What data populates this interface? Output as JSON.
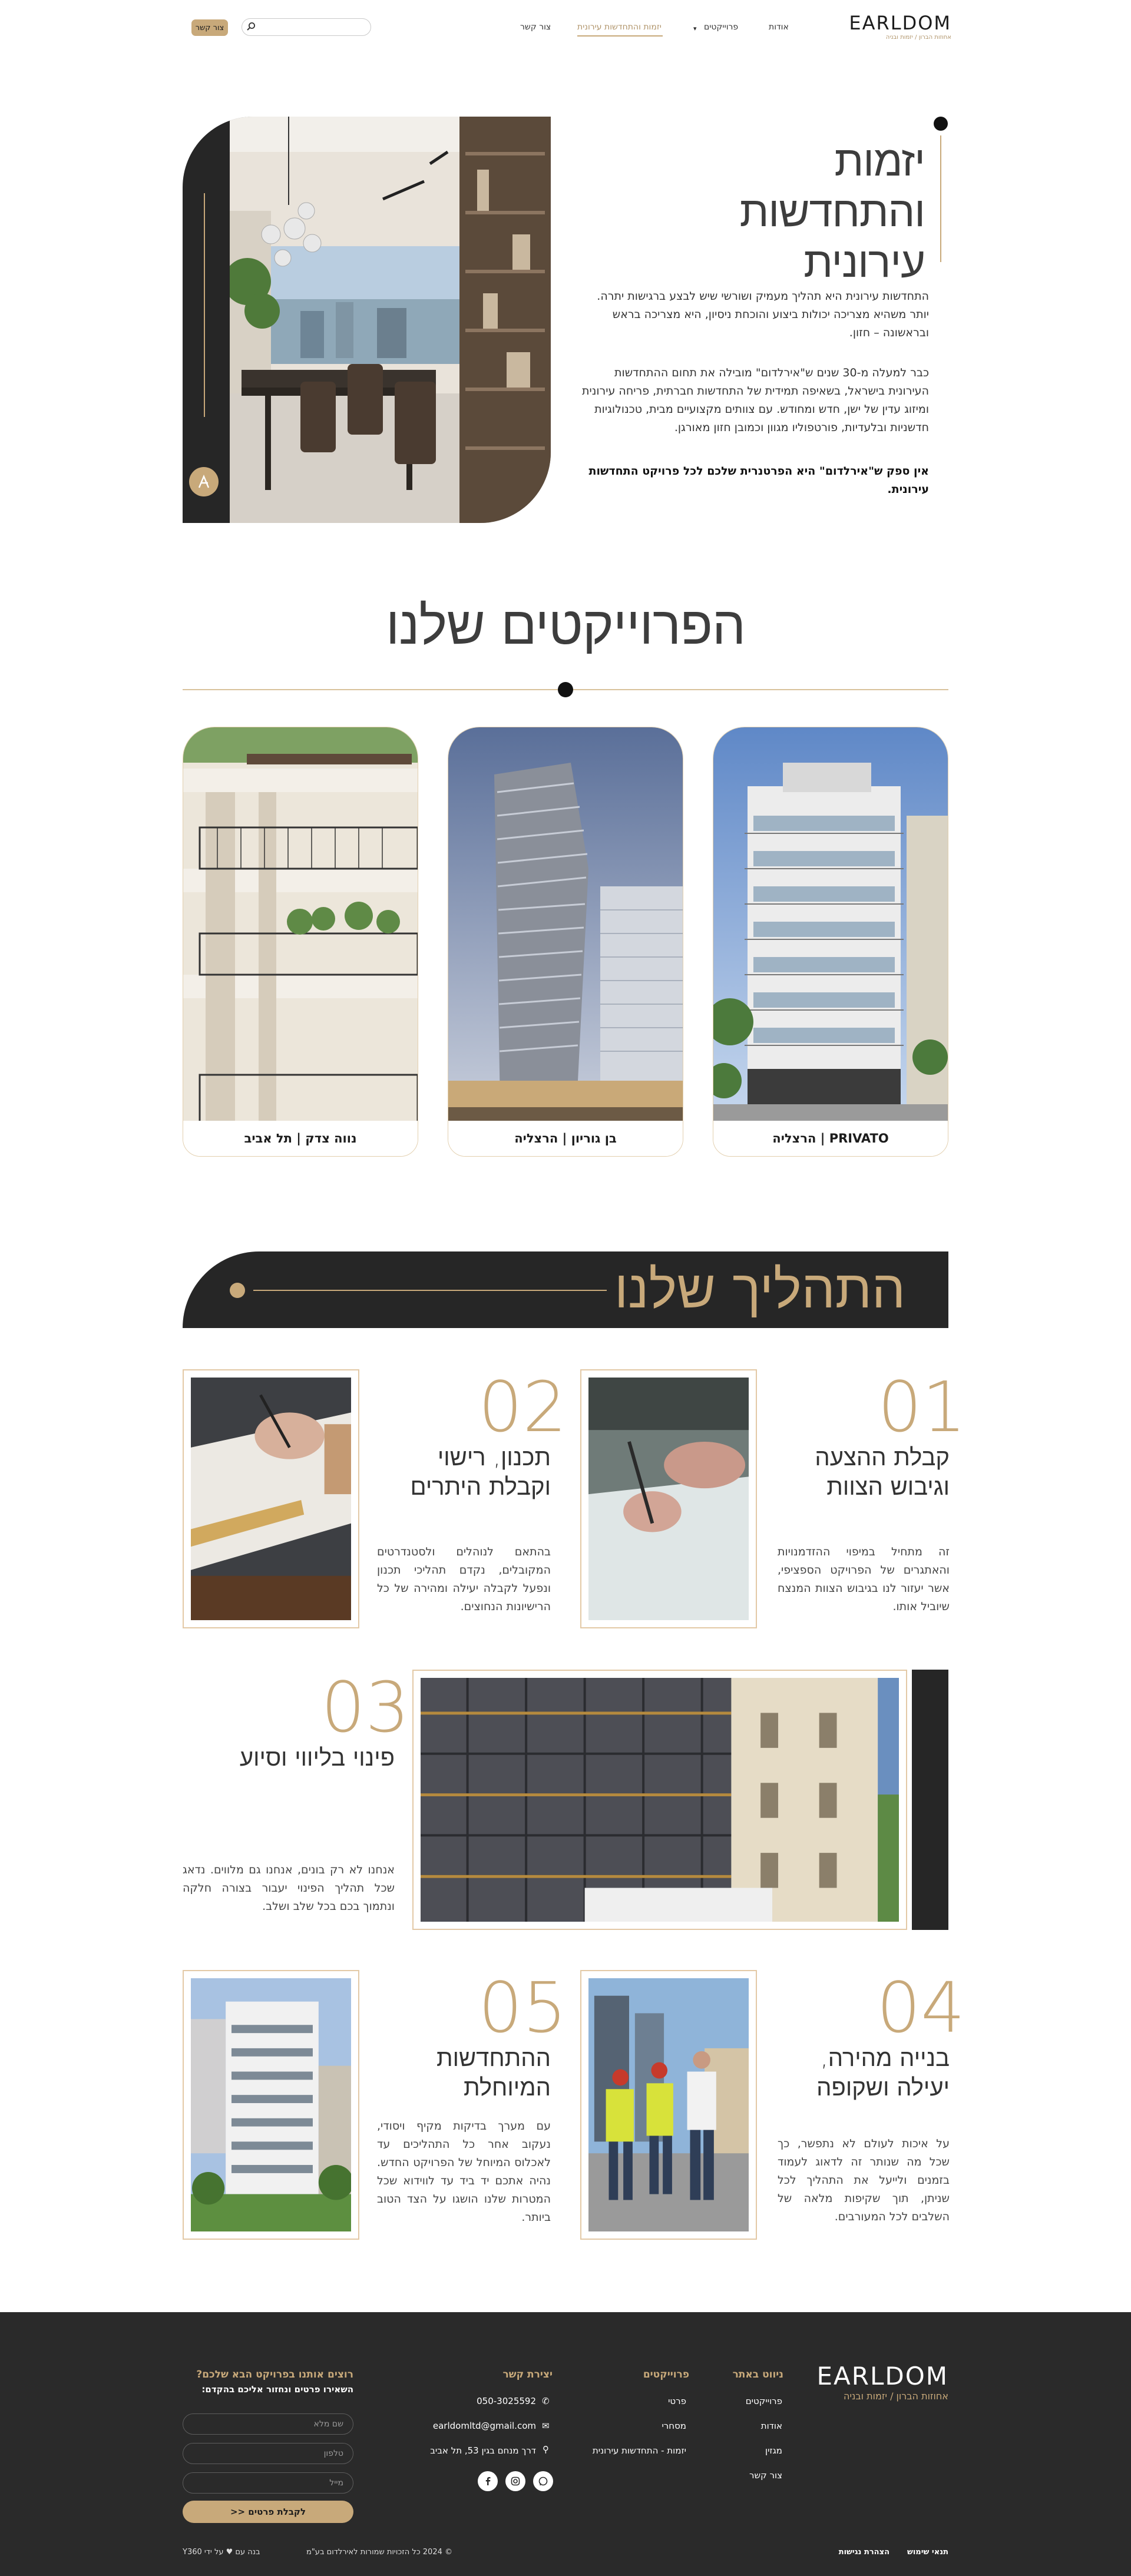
{
  "header": {
    "logo_main": "EARLDOM",
    "logo_sub": "אחוזות הברון / יזמות ובניה",
    "nav": [
      {
        "label": "אודות",
        "key": "about"
      },
      {
        "label": "פרוייקטים",
        "key": "projects"
      },
      {
        "label": "יזמות והתחדשות עירונית",
        "key": "renewal"
      },
      {
        "label": "צור קשר",
        "key": "contact"
      }
    ],
    "search_placeholder": "",
    "contact_button": "צור קשר"
  },
  "hero": {
    "title_lines": [
      "יזמות",
      "והתחדשות",
      "עירונית"
    ],
    "p1": "התחדשות עירונית היא תהליך מעמיק ושורשי שיש לבצע ברגישות יתרה. יותר משהיא מצריכה יכולות ביצוע והוכחת ניסיון, היא מצריכה בראש ובראשונה – חזון.",
    "p2": "כבר למעלה מ-30 שנים ש\"אירלדום\" מובילה את תחום ההתחדשות העירונית בישראל, בשאיפה תמידית של התחדשות חברתית, פריחה עירונית ומיזוג עדין של ישן, חדש ומחודש. עם צוותים מקצועיים מבית, טכנולוגיות חדשניות ובלעדיות, פורטפוליו מגוון וכמובן חזון מאורגן.",
    "strong": "אין ספק ש\"אירלדום\" היא הפרטנרית שלכם לכל פרויקט התחדשות עירונית."
  },
  "projects": {
    "title": "הפרוייקטים שלנו",
    "cards": [
      {
        "label": "PRIVATO | הרצליה"
      },
      {
        "label": "בן גוריון | הרצליה"
      },
      {
        "label": "נווה צדק | תל אביב"
      }
    ]
  },
  "process": {
    "title": "התהליך שלנו",
    "steps": [
      {
        "num": "01",
        "title": "קבלת ההצעה וגיבוש הצוות",
        "text": "זה מתחיל במיפוי ההזדמנויות והאתגרים של הפרויקט הספציפי, אשר יעזור לנו בגיבוש הצוות המנצח שיוביל אותו."
      },
      {
        "num": "02",
        "title": "תכנון, רישוי וקבלת היתרים",
        "text": "בהתאם לנוהלים ולסטנדרטים המקובלים, נקדם תהליכי תכנון ונפעל לקבלה יעילה ומהירה של כל הרישיונות הנחוצים."
      },
      {
        "num": "03",
        "title": "פינוי בליווי וסיוע",
        "text": "אנחנו לא רק בונים, אנחנו גם מלווים. נדאג שכל תהליך הפינוי יעבור בצורה חלקה ונתמוך בכם בכל שלב ושלב."
      },
      {
        "num": "04",
        "title": "בנייה מהירה, יעילה ושקופה",
        "text": "על איכות לעולם לא נתפשר, כך שכל מה שנותר זה לדאוג לעמוד בזמנים ולייעל את התהליך לכל שניתן, תוך שקיפות מלאה של השלבים לכל המעורבים."
      },
      {
        "num": "05",
        "title": "ההתחדשות המיוחלת",
        "text": "עם מערך בדיקות מקיף ויסודי, נעקוב אחר כל התהליכים עד לאכלוס המיוחל של הפרויקט החדש. נהיה אתכם יד ביד עד לווידוא שכל המטרות שלנו הושגו על הצד הטוב ביותר."
      }
    ]
  },
  "footer": {
    "logo_main": "EARLDOM",
    "logo_sub": "אחוזות הברון / יזמות ובניה",
    "nav_head": "ניווט באתר",
    "nav_links": [
      "פרוייקטים",
      "אודות",
      "מגזין",
      "צור קשר"
    ],
    "projects_head": "פרוייקטים",
    "projects_links": [
      "פרטי",
      "מסחרי",
      "יזמות - התחדשות עירונית"
    ],
    "contact_head": "יצירת קשר",
    "phone": "050-3025592",
    "email": "earldomltd@gmail.com",
    "address": "דרך מנחם בגין 53, תל אביב",
    "form_head": "רוצים אותנו בפרויקט הבא שלכם?",
    "form_sub": "השאירו פרטים ונחזור אליכם בהקדם:",
    "name_ph": "שם מלא",
    "phone_ph": "טלפון",
    "email_ph": "מייל",
    "submit": "לקבלת פרטים <<",
    "terms": "תנאי שימוש",
    "access": "הצהרת נגישות",
    "copyright": "© 2024 כל הזכויות שמורות לאירלדום בע\"מ",
    "credit": "בנה עם ♥ על ידי Y360"
  },
  "colors": {
    "gold": "#c8a97a",
    "dark": "#262626"
  }
}
